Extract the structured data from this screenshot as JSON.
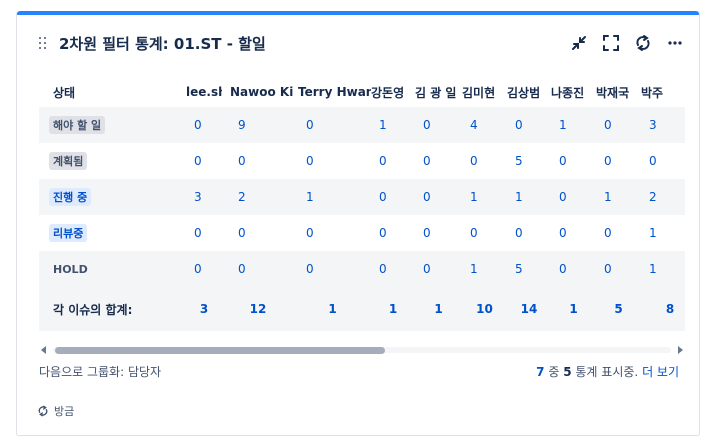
{
  "gadget": {
    "title": "2차원 필터 통계: 01.ST - 할일",
    "icons": [
      "minimize-icon",
      "fullscreen-icon",
      "refresh-icon",
      "more-icon"
    ]
  },
  "table": {
    "corner_header": "상태",
    "columns": [
      "lee.sh",
      "Nawoo Kim",
      "Terry Hwang",
      "강돈영",
      "김 광 일",
      "김미현",
      "김상범",
      "나종진",
      "박재국",
      "박주"
    ],
    "rows": [
      {
        "status": "해야 할 일",
        "style": "gray",
        "values": [
          "0",
          "9",
          "0",
          "1",
          "0",
          "4",
          "0",
          "1",
          "0",
          "3"
        ]
      },
      {
        "status": "계획됨",
        "style": "gray",
        "values": [
          "0",
          "0",
          "0",
          "0",
          "0",
          "0",
          "5",
          "0",
          "0",
          "0"
        ]
      },
      {
        "status": "진행 중",
        "style": "blue",
        "values": [
          "3",
          "2",
          "1",
          "0",
          "0",
          "1",
          "1",
          "0",
          "1",
          "2"
        ]
      },
      {
        "status": "리뷰중",
        "style": "blue",
        "values": [
          "0",
          "0",
          "0",
          "0",
          "0",
          "0",
          "0",
          "0",
          "0",
          "1"
        ]
      },
      {
        "status": "HOLD",
        "style": "plain",
        "values": [
          "0",
          "0",
          "0",
          "0",
          "0",
          "1",
          "5",
          "0",
          "0",
          "1"
        ]
      }
    ],
    "totals_label": "각 이슈의 합계:",
    "totals": [
      "3",
      "12",
      "1",
      "1",
      "1",
      "10",
      "14",
      "1",
      "5",
      "8"
    ]
  },
  "footer": {
    "group_by": "다음으로 그룹화: 담당자",
    "shown": "7",
    "of_word": "중",
    "total": "5",
    "shown_suffix": "통계 표시중.",
    "more_link": "더 보기",
    "updated": "방금"
  },
  "colors": {
    "accent": "#2684ff",
    "link": "#0052cc",
    "status_gray": "#dfe1e6",
    "status_blue": "#deebff"
  }
}
